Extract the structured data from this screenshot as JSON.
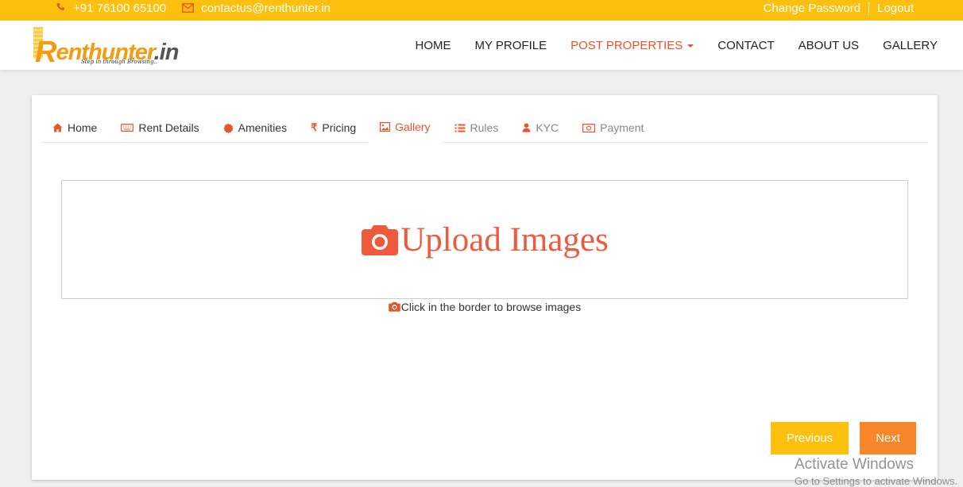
{
  "topbar": {
    "phone": "+91 76100 65100",
    "email": "contactus@renthunter.in",
    "change_password": "Change Password",
    "logout": "Logout"
  },
  "brand": {
    "logo_text": "Renthunter.in",
    "tagline": "Step in through Browsing..",
    "accent": "#e8542b",
    "yellow": "#fec00f"
  },
  "nav": {
    "items": [
      {
        "label": "HOME"
      },
      {
        "label": "MY PROFILE"
      },
      {
        "label": "POST PROPERTIES",
        "active": true
      },
      {
        "label": "CONTACT"
      },
      {
        "label": "ABOUT US"
      },
      {
        "label": "GALLERY"
      }
    ]
  },
  "tabs": [
    {
      "label": "Home",
      "icon": "home-icon"
    },
    {
      "label": "Rent Details",
      "icon": "keyboard-icon"
    },
    {
      "label": "Amenities",
      "icon": "certificate-icon"
    },
    {
      "label": "Pricing",
      "icon": "rupee-icon"
    },
    {
      "label": "Gallery",
      "icon": "image-icon",
      "active": true
    },
    {
      "label": "Rules",
      "icon": "list-icon"
    },
    {
      "label": "KYC",
      "icon": "user-icon"
    },
    {
      "label": "Payment",
      "icon": "money-icon"
    }
  ],
  "upload": {
    "title": "Upload Images",
    "hint": "Click in the border to browse images"
  },
  "buttons": {
    "previous": "Previous",
    "next": "Next"
  },
  "watermark": {
    "line1": "Activate Windows",
    "line2": "Go to Settings to activate Windows."
  }
}
